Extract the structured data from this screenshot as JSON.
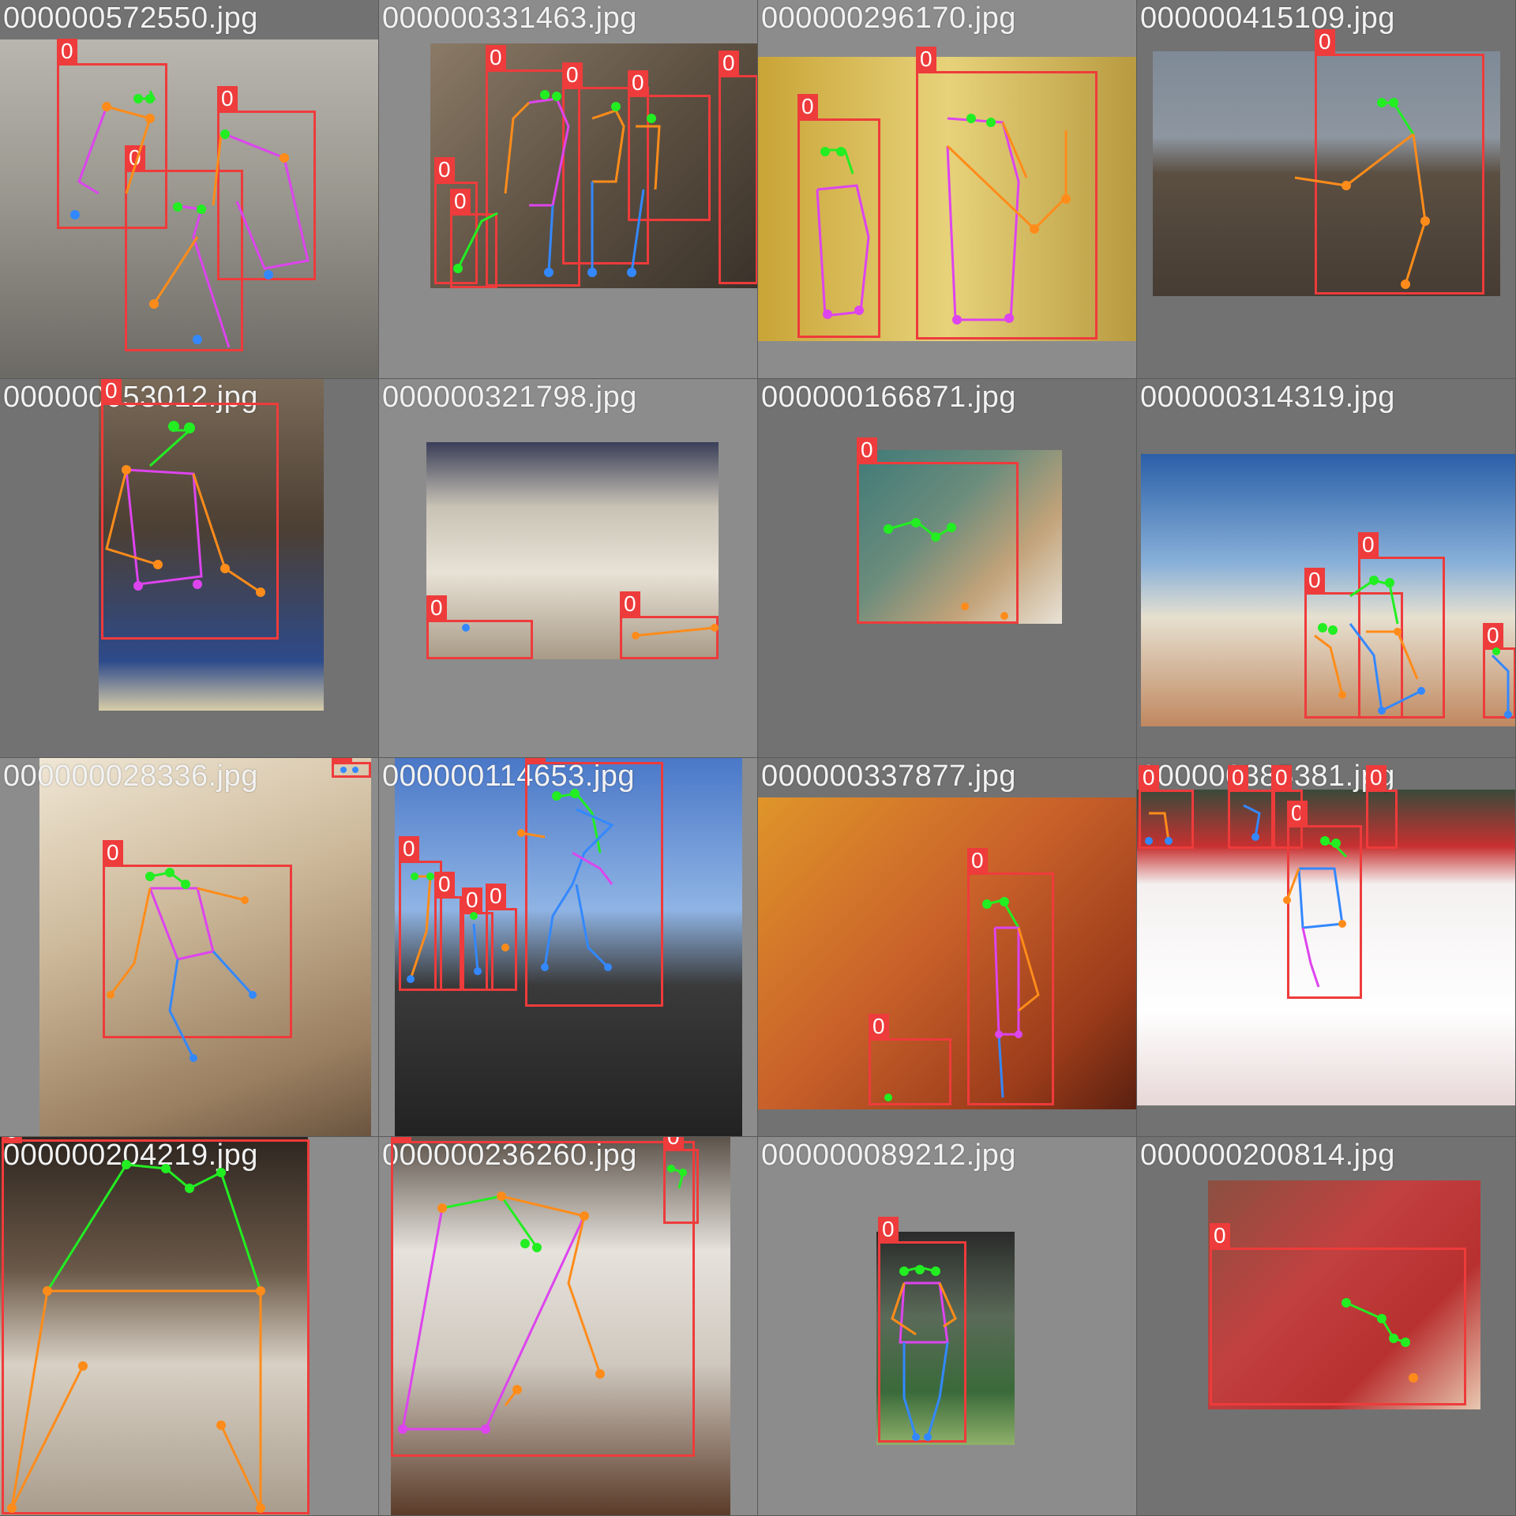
{
  "mosaic": {
    "colors": {
      "box": "#ee3b3b",
      "face": "#22ee22",
      "arm": "#ff8c1a",
      "torso": "#dd44ee",
      "leg": "#3388ff"
    },
    "tiles": [
      {
        "filename": "000000572550.jpg",
        "photo": "#8a8a82",
        "shade": "dark",
        "label": "0"
      },
      {
        "filename": "000000331463.jpg",
        "photo": "#6b5b48",
        "shade": "light",
        "label": "0"
      },
      {
        "filename": "000000296170.jpg",
        "photo": "#d8c26a",
        "shade": "light",
        "label": "0"
      },
      {
        "filename": "000000415109.jpg",
        "photo": "#5c5246",
        "shade": "dark",
        "label": "0"
      },
      {
        "filename": "000000053012.jpg",
        "photo": "#5a4a3c",
        "shade": "dark",
        "label": "0"
      },
      {
        "filename": "000000321798.jpg",
        "photo": "#b9b3a8",
        "shade": "light",
        "label": "0"
      },
      {
        "filename": "000000166871.jpg",
        "photo": "#4c6a66",
        "shade": "dark",
        "label": "0"
      },
      {
        "filename": "000000314319.jpg",
        "photo": "#8db0d6",
        "shade": "dark",
        "label": "0"
      },
      {
        "filename": "000000028336.jpg",
        "photo": "#c9b89a",
        "shade": "light",
        "label": "0"
      },
      {
        "filename": "000000114653.jpg",
        "photo": "#5f7fb8",
        "shade": "light",
        "label": "0"
      },
      {
        "filename": "000000337877.jpg",
        "photo": "#d2691e",
        "shade": "dark",
        "label": "0"
      },
      {
        "filename": "000000385381.jpg",
        "photo": "#e8e2e2",
        "shade": "dark",
        "label": "0"
      },
      {
        "filename": "000000204219.jpg",
        "photo": "#3d342c",
        "shade": "light",
        "label": "0"
      },
      {
        "filename": "000000236260.jpg",
        "photo": "#4a4440",
        "shade": "light",
        "label": "0"
      },
      {
        "filename": "000000089212.jpg",
        "photo": "#3f6b4a",
        "shade": "light",
        "label": "0"
      },
      {
        "filename": "000000200814.jpg",
        "photo": "#b02a2a",
        "shade": "dark",
        "label": "0"
      }
    ]
  }
}
